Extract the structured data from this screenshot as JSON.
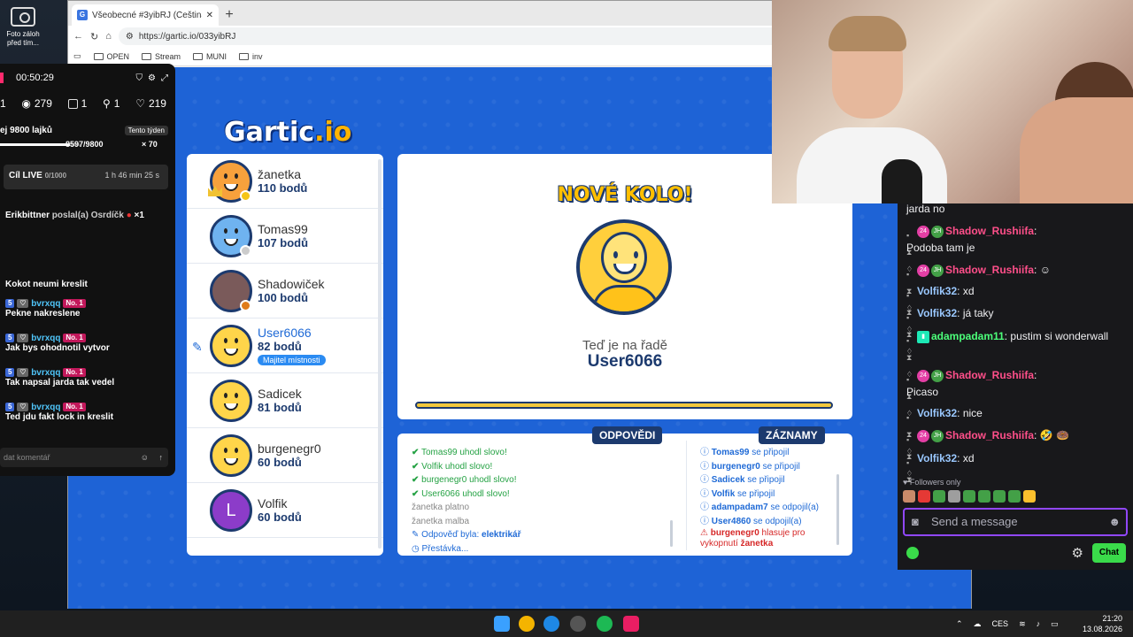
{
  "desktop": {
    "icon_label": "Foto zál­oh před tím..."
  },
  "browser": {
    "tab_title": "Všeobecné #3yibRJ (Čeština) - Gar",
    "favicon": "G",
    "url": "https://gartic.io/033yibRJ",
    "bookmarks": [
      "OPEN",
      "Stream",
      "MUNI",
      "inv"
    ]
  },
  "gartic": {
    "logo_main": "Gartic",
    "logo_suffix": ".io",
    "players": [
      {
        "name": "žanetka",
        "points": "110 bodů",
        "dot": "#f5c518"
      },
      {
        "name": "Tomas99",
        "points": "107 bodů",
        "dot": "#cccccc"
      },
      {
        "name": "Shadowiček",
        "points": "100 bodů",
        "dot": "#e07b1a"
      },
      {
        "name": "User6066",
        "points": "82 bodů",
        "badge": "Majitel místnosti"
      },
      {
        "name": "Sadicek",
        "points": "81 bodů"
      },
      {
        "name": "burgenegr0",
        "points": "60 bodů"
      },
      {
        "name": "Volfik",
        "points": "60 bodů",
        "initial": "L"
      }
    ],
    "new_round": "NOVÉ KOLO!",
    "turn_text": "Teď je na řadě",
    "turn_user": "User6066",
    "answers_header": "ODPOVĚDI",
    "records_header": "ZÁZNAMY",
    "answers": [
      {
        "name": "Tomas99",
        "text": "uhodl slovo!"
      },
      {
        "name": "Volfik",
        "text": "uhodl slovo!"
      },
      {
        "name": "burgenegr0",
        "text": "uhodl slovo!"
      },
      {
        "name": "User6066",
        "text": "uhodl slovo!"
      }
    ],
    "answers_grey": [
      {
        "name": "žanetka",
        "text": "platno"
      },
      {
        "name": "žanetka",
        "text": "malba"
      }
    ],
    "answer_was_label": "Odpověď byla:",
    "answer_was_word": "elektrikář",
    "pause": "Přestávka...",
    "records": [
      {
        "name": "Tomas99",
        "text": "se připojil"
      },
      {
        "name": "burgenegr0",
        "text": "se připojil"
      },
      {
        "name": "Sadicek",
        "text": "se připojil"
      },
      {
        "name": "Volfik",
        "text": "se připojil"
      },
      {
        "name": "adampadam7",
        "text": "se odpojil(a)"
      },
      {
        "name": "User4860",
        "text": "se odpojil(a)"
      }
    ],
    "report_name": "burgenegr0",
    "report_text": "hlasuje pro",
    "report_text2": "vykopnutí",
    "report_target": "žanetka"
  },
  "tiktok": {
    "time": "00:50:29",
    "stats": [
      "1",
      "279",
      "1",
      "1",
      "219"
    ],
    "goal_label": "ej 9800 lajků",
    "week_label": "Tento týden",
    "goal_progress": "8597/9800",
    "goal_fraction": 0.877,
    "multiplier": "× 70",
    "live_label": "Cíl LIVE",
    "live_count": "0/1000",
    "live_time": "1 h 46 min 25 s",
    "gift_user": "Erikbittner",
    "gift_text": "poslal(a) Osrdíčk",
    "gift_count": "×1",
    "messages": [
      {
        "text": "Kokot neumi kreslit"
      },
      {
        "user": "bvrxqq",
        "level": "5",
        "rank": "No. 1",
        "text": "Pekne nakreslene"
      },
      {
        "user": "bvrxqq",
        "level": "5",
        "rank": "No. 1",
        "text": "Jak bys ohodnotil vytvor"
      },
      {
        "user": "bvrxqq",
        "level": "5",
        "rank": "No. 1",
        "text": "Tak napsal jarda tak vedel"
      },
      {
        "user": "bvrxqq",
        "level": "5",
        "rank": "No. 1",
        "text": "Ted jdu fakt lock in kreslit"
      }
    ],
    "input_placeholder": "dat komentář"
  },
  "twitch": {
    "messages": [
      {
        "text": "jarda no"
      },
      {
        "user": "Shadow_Rushiifa",
        "color": "pink",
        "text": "Podoba tam je",
        "subs": "24",
        "initials": "JH"
      },
      {
        "user": "Shadow_Rushiifa",
        "color": "pink",
        "text": "",
        "subs": "24",
        "initials": "JH"
      },
      {
        "user": "Volfik32",
        "color": "blue",
        "text": "xd"
      },
      {
        "user": "Volfik32",
        "color": "blue",
        "text": "já taky"
      },
      {
        "user": "adampadam11",
        "color": "green",
        "text": "pustim si wonderwall"
      },
      {
        "user": "Shadow_Rushiifa",
        "color": "pink",
        "text": "Picaso",
        "subs": "24",
        "initials": "JH"
      },
      {
        "user": "Volfik32",
        "color": "blue",
        "text": "nice"
      },
      {
        "user": "Shadow_Rushiifa",
        "color": "pink",
        "text": "🤣 🍩",
        "subs": "24",
        "initials": "JH"
      },
      {
        "user": "Volfik32",
        "color": "blue",
        "text": "xd"
      }
    ],
    "followers_only": "Followers only",
    "input_placeholder": "Send a message",
    "chat_button": "Chat"
  },
  "taskbar": {
    "lang": "CES",
    "time": "21:20",
    "date": "13.08.2026"
  }
}
